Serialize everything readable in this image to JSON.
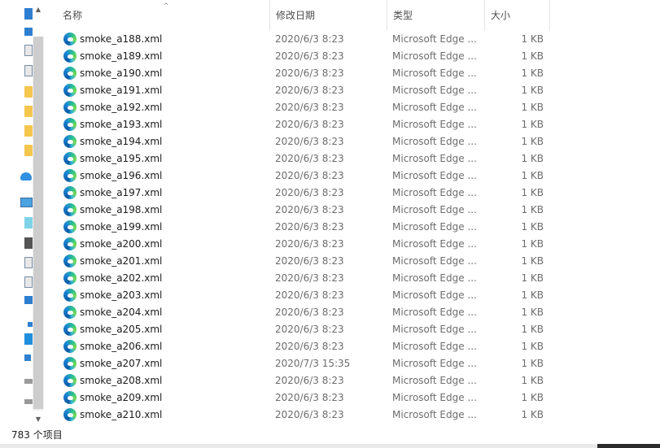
{
  "columns": {
    "name": "名称",
    "date": "修改日期",
    "type": "类型",
    "size": "大小"
  },
  "sort_indicator": "^",
  "status": {
    "item_count": "783 个项目"
  },
  "files": [
    {
      "name": "smoke_a188.xml",
      "date": "2020/6/3 8:23",
      "type": "Microsoft Edge ...",
      "size": "1 KB"
    },
    {
      "name": "smoke_a189.xml",
      "date": "2020/6/3 8:23",
      "type": "Microsoft Edge ...",
      "size": "1 KB"
    },
    {
      "name": "smoke_a190.xml",
      "date": "2020/6/3 8:23",
      "type": "Microsoft Edge ...",
      "size": "1 KB"
    },
    {
      "name": "smoke_a191.xml",
      "date": "2020/6/3 8:23",
      "type": "Microsoft Edge ...",
      "size": "1 KB"
    },
    {
      "name": "smoke_a192.xml",
      "date": "2020/6/3 8:23",
      "type": "Microsoft Edge ...",
      "size": "1 KB"
    },
    {
      "name": "smoke_a193.xml",
      "date": "2020/6/3 8:23",
      "type": "Microsoft Edge ...",
      "size": "1 KB"
    },
    {
      "name": "smoke_a194.xml",
      "date": "2020/6/3 8:23",
      "type": "Microsoft Edge ...",
      "size": "1 KB"
    },
    {
      "name": "smoke_a195.xml",
      "date": "2020/6/3 8:23",
      "type": "Microsoft Edge ...",
      "size": "1 KB"
    },
    {
      "name": "smoke_a196.xml",
      "date": "2020/6/3 8:23",
      "type": "Microsoft Edge ...",
      "size": "1 KB"
    },
    {
      "name": "smoke_a197.xml",
      "date": "2020/6/3 8:23",
      "type": "Microsoft Edge ...",
      "size": "1 KB"
    },
    {
      "name": "smoke_a198.xml",
      "date": "2020/6/3 8:23",
      "type": "Microsoft Edge ...",
      "size": "1 KB"
    },
    {
      "name": "smoke_a199.xml",
      "date": "2020/6/3 8:23",
      "type": "Microsoft Edge ...",
      "size": "1 KB"
    },
    {
      "name": "smoke_a200.xml",
      "date": "2020/6/3 8:23",
      "type": "Microsoft Edge ...",
      "size": "1 KB"
    },
    {
      "name": "smoke_a201.xml",
      "date": "2020/6/3 8:23",
      "type": "Microsoft Edge ...",
      "size": "1 KB"
    },
    {
      "name": "smoke_a202.xml",
      "date": "2020/6/3 8:23",
      "type": "Microsoft Edge ...",
      "size": "1 KB"
    },
    {
      "name": "smoke_a203.xml",
      "date": "2020/6/3 8:23",
      "type": "Microsoft Edge ...",
      "size": "1 KB"
    },
    {
      "name": "smoke_a204.xml",
      "date": "2020/6/3 8:23",
      "type": "Microsoft Edge ...",
      "size": "1 KB"
    },
    {
      "name": "smoke_a205.xml",
      "date": "2020/6/3 8:23",
      "type": "Microsoft Edge ...",
      "size": "1 KB"
    },
    {
      "name": "smoke_a206.xml",
      "date": "2020/6/3 8:23",
      "type": "Microsoft Edge ...",
      "size": "1 KB"
    },
    {
      "name": "smoke_a207.xml",
      "date": "2020/7/3 15:35",
      "type": "Microsoft Edge ...",
      "size": "1 KB"
    },
    {
      "name": "smoke_a208.xml",
      "date": "2020/6/3 8:23",
      "type": "Microsoft Edge ...",
      "size": "1 KB"
    },
    {
      "name": "smoke_a209.xml",
      "date": "2020/6/3 8:23",
      "type": "Microsoft Edge ...",
      "size": "1 KB"
    },
    {
      "name": "smoke_a210.xml",
      "date": "2020/6/3 8:23",
      "type": "Microsoft Edge ...",
      "size": "1 KB"
    }
  ],
  "file_icon": "edge-document-icon",
  "nav_icons": [
    "folder-icon",
    "download-icon",
    "document-icon",
    "image-icon",
    "folder-icon",
    "folder-icon",
    "folder-icon",
    "folder-icon",
    "onedrive-icon",
    "this-pc-icon",
    "3d-objects-icon",
    "video-icon",
    "document-icon",
    "document-icon",
    "download-icon",
    "music-icon",
    "windows-drive-icon",
    "drive-icon",
    "drive-icon",
    "drive-icon"
  ]
}
